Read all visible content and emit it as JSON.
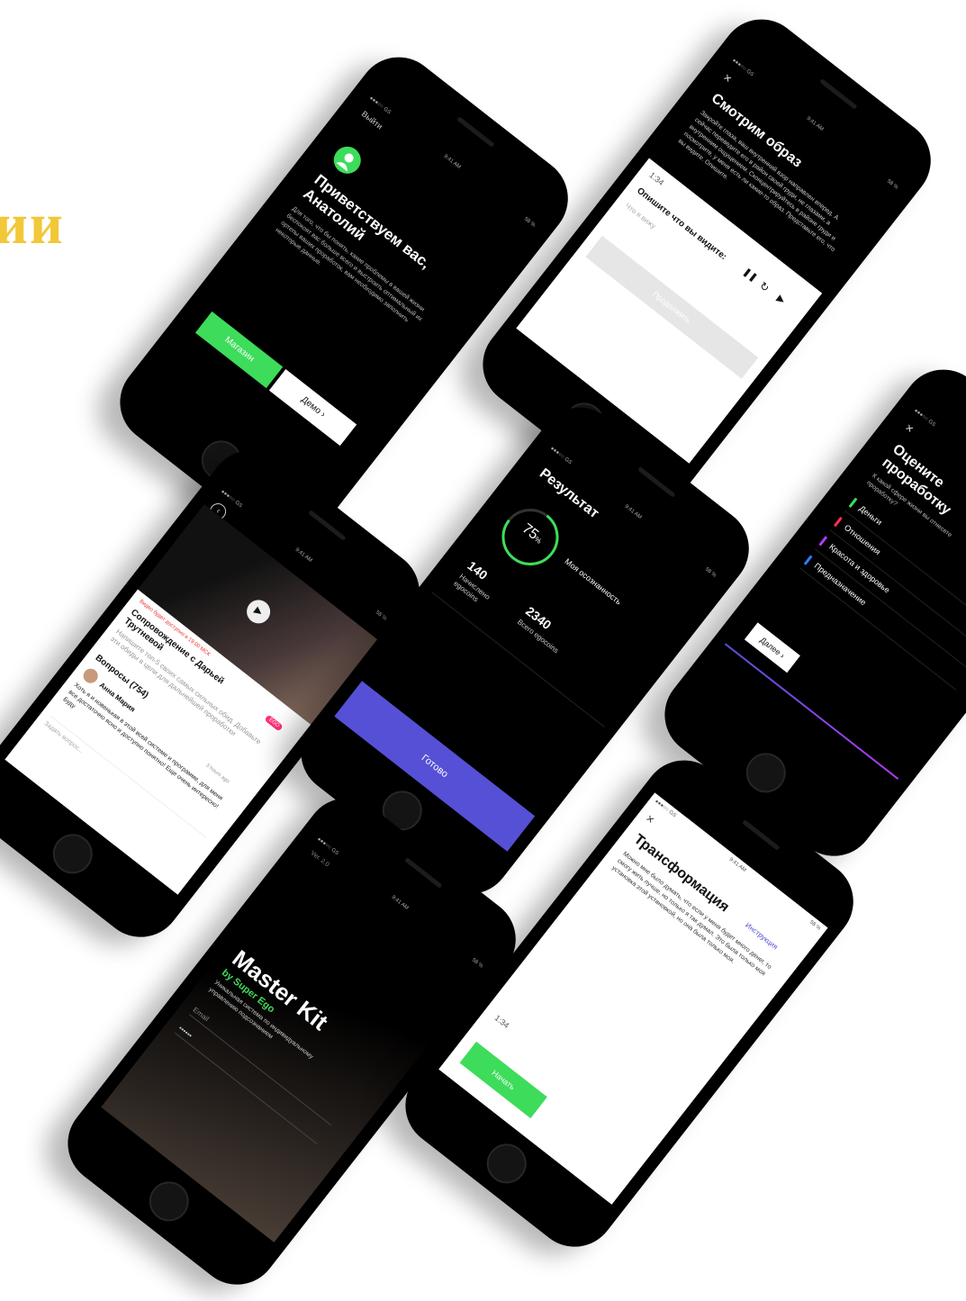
{
  "hero_title_fragment": "ии",
  "status": {
    "carrier": "●●●○○ GS",
    "time": "9:41 AM",
    "battery": "58 %"
  },
  "welcome": {
    "exit_label": "Выйти",
    "title": "Приветствуем вас, Анатолий",
    "body": "Для того, что бы понять, какие проблемы в вашей жизни беспокоят вас больше всего и выстроить оптимальный их ортепы ваших проработок, вам необходимо заполнить некоторые данные.",
    "shop_button": "Магазин",
    "demo_button": "Демо ›"
  },
  "image": {
    "close_label": "×",
    "title": "Смотрим образ",
    "body": "Закройте глаза, ваш внутренний взор направлен вперед. А сейчас переведите его в район своей груди, не глазами, а внутренним ощущением. Сконцентрируйтесь в районе груди и посмотрите, у меня есть ли какие-то образ. Представьте его, что вы видите. Опишите.",
    "timer": "1:34",
    "prompt": "Опишите что вы видите:",
    "placeholder": "Что я вижу",
    "pause_icon": "pause-icon",
    "replay_icon": "replay-icon",
    "play_icon": "play-icon",
    "continue_button": "Продолжить"
  },
  "video": {
    "notice": "Видео будет доступно в 19:00 МСК",
    "title": "Сопровождение с Дарьей Трутневой",
    "description": "Напишите топ-5 своих самых сильных обид. Добавьте эти обиды в цели для дальнейшей проработки",
    "badge": "EGO",
    "questions_title": "Вопросы (754)",
    "author": "Анна Мария",
    "time_ago": "3 hours ago",
    "comment": "Хоть я и новенькая в этой всей системе и программе, для меня все достаточно ясно и доступно понятно! Еще очень интересно! Буду",
    "input_placeholder": "Задать вопрос..."
  },
  "result": {
    "title": "Результат",
    "percent": "75",
    "percent_unit": "%",
    "percent_value": 0.75,
    "awareness_label": "Моя осознанность",
    "earned_value": "140",
    "earned_label": "Начислено egocoins",
    "total_value": "2340",
    "total_label": "Всего egocoins",
    "done_button": "Готово"
  },
  "rate": {
    "close_label": "×",
    "title": "Оцените проработку",
    "subtitle": "К какой сфере жизни вы отнесете проработку?",
    "items": [
      {
        "label": "Деньги",
        "color": "#3ddc5b"
      },
      {
        "label": "Отношения",
        "color": "#ff2d55"
      },
      {
        "label": "Красота и здоровье",
        "color": "#b03cff"
      },
      {
        "label": "Предназначение",
        "color": "#2f7bff"
      }
    ],
    "next_button": "Далее ›"
  },
  "login": {
    "version": "Ver. 2.0",
    "title": "Master Kit",
    "byline": "by Super Ego",
    "description": "Уникальная система по индивидуальному управлению подсознанием",
    "email_placeholder": "Email",
    "password_mask": "••••••"
  },
  "transform": {
    "close_label": "×",
    "title": "Трансформация",
    "instruction_link": "Инструкция",
    "body": "Можно мне было думать, что если у меня будет много денег, то смогу жить лучше, но только я так думал. Это была только моя установка этой установкой, но она была только моя.",
    "timer": "1:34",
    "start_button": "Начать"
  },
  "colors": {
    "accent_green": "#3ddc5b",
    "accent_purple": "#5650d6",
    "hero_yellow": "#f2c738"
  }
}
